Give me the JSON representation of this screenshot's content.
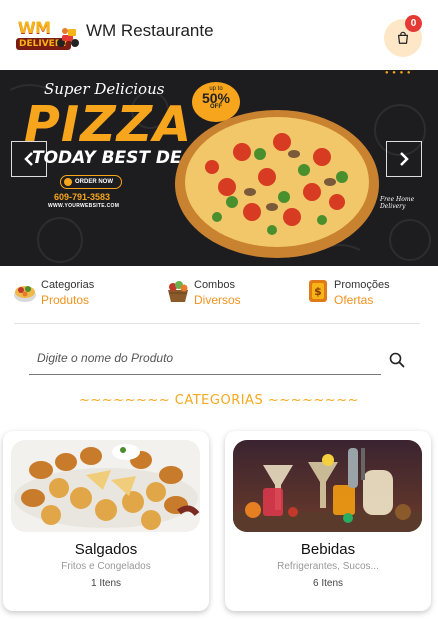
{
  "header": {
    "logo_text": "WM",
    "logo_sub": "DELIVERY",
    "title": "WM Restaurante",
    "cart_count": "0"
  },
  "banner": {
    "subtitle": "Super Delicious",
    "headline": "PIZZA",
    "deal": "TODAY BEST DEAL",
    "order_button": "ORDER NOW",
    "phone": "609-791-3583",
    "website": "WWW.YOURWEBSITE.COM",
    "badge_upto": "up to",
    "badge_percent": "50%",
    "badge_off": "OFF",
    "free_delivery": "Free Home Delivery"
  },
  "menu": [
    {
      "label": "Categorias",
      "sub": "Produtos",
      "icon": "categories-icon"
    },
    {
      "label": "Combos",
      "sub": "Diversos",
      "icon": "combos-icon"
    },
    {
      "label": "Promoções",
      "sub": "Ofertas",
      "icon": "promotions-icon"
    }
  ],
  "search": {
    "placeholder": "Digite o nome do Produto"
  },
  "categories_title": "~~~~~~~~ CATEGORIAS ~~~~~~~~",
  "categories": [
    {
      "name": "Salgados",
      "description": "Fritos e Congelados",
      "count": "1 Itens"
    },
    {
      "name": "Bebidas",
      "description": "Refrigerantes, Sucos...",
      "count": "6 Itens"
    }
  ],
  "colors": {
    "accent": "#f0931e",
    "banner_bg": "#1d1d1f",
    "badge": "#e53935",
    "cart_bg": "#fde7c7"
  }
}
